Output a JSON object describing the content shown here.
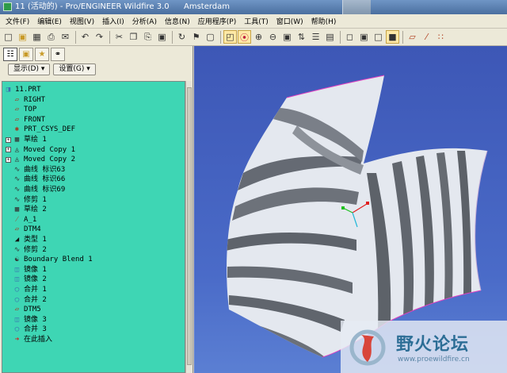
{
  "window": {
    "title": "11 (活动的) - Pro/ENGINEER Wildfire 3.0",
    "background_label": "Amsterdam"
  },
  "menubar": {
    "items": [
      "文件(F)",
      "编辑(E)",
      "视图(V)",
      "插入(I)",
      "分析(A)",
      "信息(N)",
      "应用程序(P)",
      "工具(T)",
      "窗口(W)",
      "帮助(H)"
    ]
  },
  "toolbar": {
    "icons": [
      "new-icon",
      "open-icon",
      "save-icon",
      "print-icon",
      "email-icon",
      "undo-icon",
      "redo-icon",
      "cut-icon",
      "copy-icon",
      "paste-icon",
      "paste-special-icon",
      "regenerate-icon",
      "find-icon",
      "select-box-icon",
      "saved-view-icon",
      "datum-display-icon",
      "zoom-in-icon",
      "zoom-out-icon",
      "refit-icon",
      "reorient-icon",
      "view-list-icon",
      "layers-icon",
      "wireframe-icon",
      "hidden-line-icon",
      "no-hidden-icon",
      "shading-icon",
      "datum-plane-icon",
      "datum-axis-icon",
      "datum-point-icon"
    ]
  },
  "panel": {
    "display_label": "显示(D)",
    "settings_label": "设置(G)"
  },
  "tree": [
    {
      "label": "11.PRT",
      "icon": "part-icon",
      "expander": false
    },
    {
      "label": "RIGHT",
      "icon": "datum-plane-icon",
      "expander": false
    },
    {
      "label": "TOP",
      "icon": "datum-plane-icon",
      "expander": false
    },
    {
      "label": "FRONT",
      "icon": "datum-plane-icon",
      "expander": false
    },
    {
      "label": "PRT_CSYS_DEF",
      "icon": "csys-icon",
      "expander": false
    },
    {
      "label": "草绘 1",
      "icon": "sketch-icon",
      "expander": true
    },
    {
      "label": "Moved Copy 1",
      "icon": "moved-copy-icon",
      "expander": true
    },
    {
      "label": "Moved Copy 2",
      "icon": "moved-copy-icon",
      "expander": true
    },
    {
      "label": "曲线 标识63",
      "icon": "curve-icon",
      "expander": false
    },
    {
      "label": "曲线 标识66",
      "icon": "curve-icon",
      "expander": false
    },
    {
      "label": "曲线 标识69",
      "icon": "curve-icon",
      "expander": false
    },
    {
      "label": "修剪 1",
      "icon": "curve-icon",
      "expander": false
    },
    {
      "label": "草绘 2",
      "icon": "sketch-icon",
      "expander": false
    },
    {
      "label": "A_1",
      "icon": "datum-axis-icon",
      "expander": false
    },
    {
      "label": "DTM4",
      "icon": "datum-plane-icon",
      "expander": false
    },
    {
      "label": "类型 1",
      "icon": "type-icon",
      "expander": false
    },
    {
      "label": "修剪 2",
      "icon": "curve-icon",
      "expander": false
    },
    {
      "label": "Boundary Blend 1",
      "icon": "boundary-blend-icon",
      "expander": false
    },
    {
      "label": "镜像 1",
      "icon": "mirror-icon",
      "expander": false
    },
    {
      "label": "镜像 2",
      "icon": "mirror-icon",
      "expander": false
    },
    {
      "label": "合并 1",
      "icon": "merge-icon",
      "expander": false
    },
    {
      "label": "合并 2",
      "icon": "merge-icon",
      "expander": false
    },
    {
      "label": "DTM5",
      "icon": "datum-plane-icon",
      "expander": false
    },
    {
      "label": "镜像 3",
      "icon": "mirror-icon",
      "expander": false
    },
    {
      "label": "合并 3",
      "icon": "merge-icon",
      "expander": false
    },
    {
      "label": "在此插入",
      "icon": "insert-here-icon",
      "expander": false
    }
  ],
  "watermark": {
    "title": "野火论坛",
    "url": "www.proewildfire.cn"
  },
  "colors": {
    "tree_background": "#3ed6b4",
    "viewport_background": "#4a6bc8",
    "surface_light": "#e4e8ef",
    "surface_dark": "#646971"
  }
}
